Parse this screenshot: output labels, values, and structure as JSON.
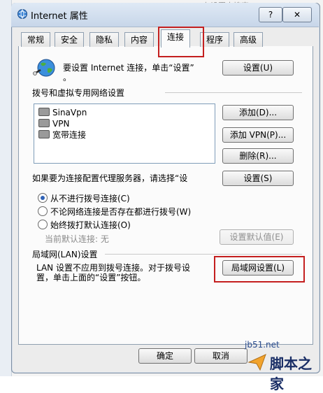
{
  "window": {
    "title": "Internet 属性",
    "help_label": "?",
    "close_label": "✕"
  },
  "background": {
    "top_text": "左设置中搜索"
  },
  "tabs": [
    {
      "label": "常规"
    },
    {
      "label": "安全"
    },
    {
      "label": "隐私"
    },
    {
      "label": "内容"
    },
    {
      "label": "连接",
      "active": true
    },
    {
      "label": "程序"
    },
    {
      "label": "高级"
    }
  ],
  "setup": {
    "text": "要设置 Internet 连接，单击“设置”",
    "text_cont": "。",
    "button": "设置(U)"
  },
  "dialup": {
    "group_title": "拨号和虚拟专用网络设置",
    "items": [
      {
        "label": "SinaVpn"
      },
      {
        "label": "VPN"
      },
      {
        "label": "宽带连接"
      }
    ],
    "add_button": "添加(D)...",
    "add_vpn_button": "添加 VPN(P)...",
    "delete_button": "删除(R)...",
    "proxy_text": "如果要为连接配置代理服务器，请选择“设",
    "proxy_button": "设置(S)"
  },
  "radios": [
    {
      "label": "从不进行拨号连接(C)",
      "selected": true
    },
    {
      "label": "不论网络连接是否存在都进行拨号(W)",
      "selected": false
    },
    {
      "label": "始终拨打默认连接(O)",
      "selected": false
    }
  ],
  "default_conn": {
    "label": "当前默认连接: 无",
    "button": "设置默认值(E)"
  },
  "lan": {
    "group_title": "局域网(LAN)设置",
    "text_line1": "LAN 设置不应用到拨号连接。对于拨号设",
    "text_line2": "置，单击上面的“设置”按钮。",
    "button": "局域网设置(L)"
  },
  "footer": {
    "ok": "确定",
    "cancel": "取消"
  },
  "watermark": {
    "site": "jb51.net",
    "name": "脚本之家"
  },
  "colors": {
    "highlight_box": "#c41f1f",
    "accent": "#2f62b6"
  }
}
